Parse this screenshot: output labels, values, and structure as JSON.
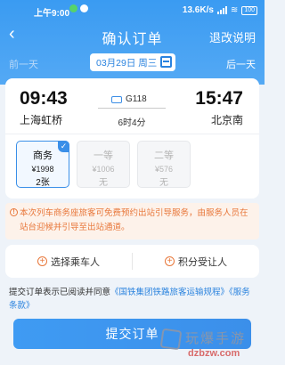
{
  "status_bar": {
    "time": "上午9:00",
    "net_speed": "13.6K/s",
    "battery": "100"
  },
  "header": {
    "back_icon": "chevron-left",
    "title": "确认订单",
    "help": "退改说明"
  },
  "date_bar": {
    "prev": "前一天",
    "date": "03月29日 周三",
    "next": "后一天"
  },
  "train": {
    "departure_time": "09:43",
    "departure_station": "上海虹桥",
    "arrival_time": "15:47",
    "arrival_station": "北京南",
    "number": "G118",
    "duration": "6时4分"
  },
  "seats": [
    {
      "name": "商务",
      "price": "¥1998",
      "count": "2张",
      "selected": true
    },
    {
      "name": "一等",
      "price": "¥1006",
      "count": "无",
      "selected": false
    },
    {
      "name": "二等",
      "price": "¥576",
      "count": "无",
      "selected": false
    }
  ],
  "notice": {
    "text": "本次列车商务座旅客可免费预约出站引导服务，由服务人员在站台迎候并引导至出站通道。"
  },
  "actions": {
    "select_passenger": "选择乘车人",
    "points_passenger": "积分受让人"
  },
  "agreement": {
    "prefix": "提交订单表示已阅读并同意",
    "link1": "《国铁集团铁路旅客运输规程》",
    "link2": "《服务条款》"
  },
  "submit_label": "提交订单",
  "watermark": {
    "cn": "玩爆手游",
    "en": "dzbzw.com"
  },
  "colors": {
    "brand_blue": "#3a9bf2",
    "warn_orange": "#e8773a",
    "link_blue": "#2b83de"
  }
}
